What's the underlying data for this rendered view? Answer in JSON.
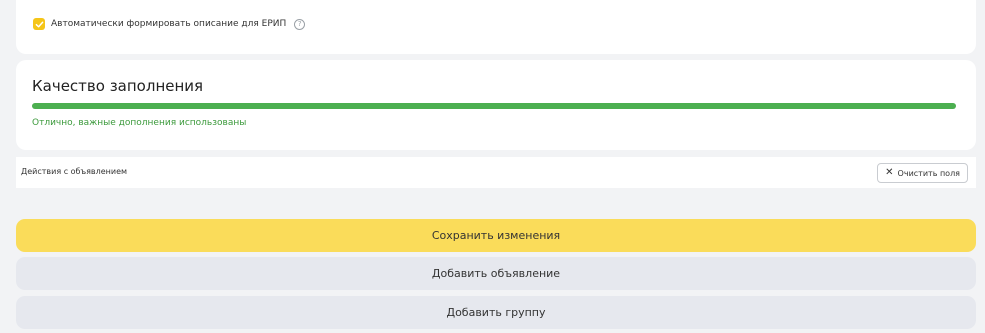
{
  "auto_description": {
    "checked": true,
    "label": "Автоматически формировать описание для ЕРИП",
    "help_icon": "question-circle-icon",
    "check_color": "#f5c518"
  },
  "quality": {
    "title": "Качество заполнения",
    "progress_percent": 100,
    "progress_color": "#4caf50",
    "status": "Отлично, важные дополнения использованы"
  },
  "actions": {
    "label": "Действия с объявлением",
    "clear_button": "Очистить поля",
    "clear_icon": "close-icon"
  },
  "buttons": {
    "save": "Сохранить изменения",
    "add_ad": "Добавить объявление",
    "add_group": "Добавить группу",
    "save_color": "#fadc5a"
  }
}
